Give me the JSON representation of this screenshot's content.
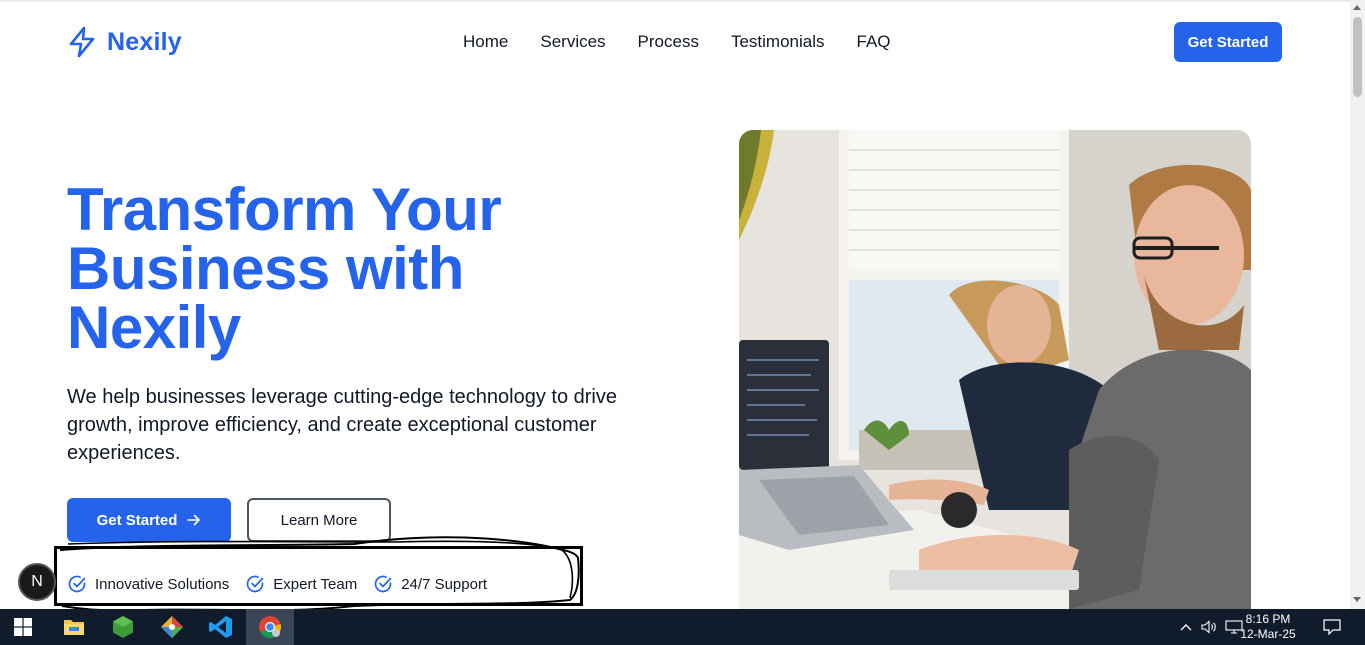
{
  "header": {
    "brand_name": "Nexily",
    "nav": [
      "Home",
      "Services",
      "Process",
      "Testimonials",
      "FAQ"
    ],
    "cta_label": "Get Started"
  },
  "hero": {
    "title_lines": [
      "Transform Your",
      "Business with",
      "Nexily"
    ],
    "subtitle": "We help businesses leverage cutting-edge technology to drive growth, improve efficiency, and create exceptional customer experiences.",
    "primary_button": "Get Started",
    "secondary_button": "Learn More",
    "features": [
      "Innovative Solutions",
      "Expert Team",
      "24/7 Support"
    ]
  },
  "dev_badge": "N",
  "taskbar": {
    "apps": [
      "windows-start-icon",
      "file-explorer-icon",
      "nodejs-icon",
      "git-icon",
      "vscode-icon",
      "chrome-icon"
    ],
    "time": "8:16 PM",
    "date": "12-Mar-25"
  },
  "colors": {
    "accent": "#2563eb",
    "text": "#111827",
    "taskbar": "#101c2c"
  }
}
